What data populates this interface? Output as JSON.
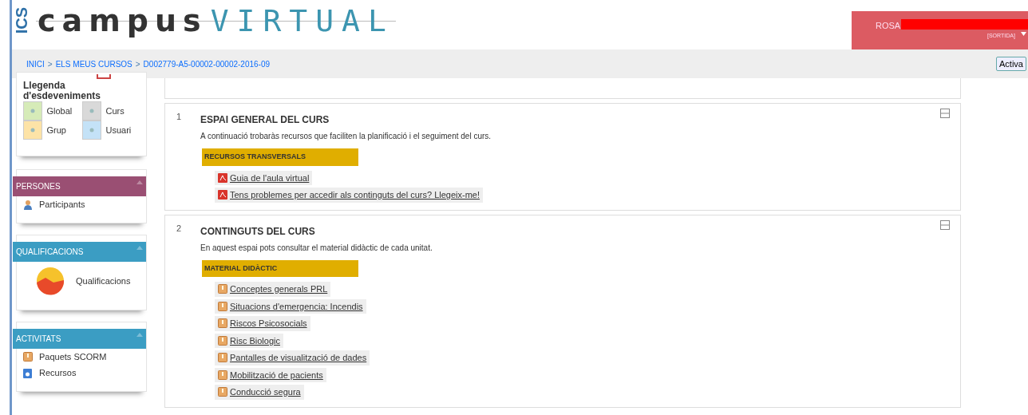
{
  "header": {
    "logo": {
      "side": "ICS",
      "word_1": "campus",
      "word_2": "VIRTUAL"
    },
    "user": {
      "name": "ROSA",
      "logout": "[SORTIDA]"
    }
  },
  "breadcrumb": [
    {
      "label": "INICI",
      "separator": ">"
    },
    {
      "label": "ELS MEUS CURSOS",
      "separator": ">"
    },
    {
      "label": "D002779-A5-00002-00002-2016-09"
    }
  ],
  "activate_button": "Activa",
  "sidebar": {
    "legend": {
      "title": "Llegenda d'esdeveniments",
      "items": [
        {
          "label": "Global",
          "color": "#d6ebb8"
        },
        {
          "label": "Curs",
          "color": "#d9d9d9"
        },
        {
          "label": "Grup",
          "color": "#fde3a7"
        },
        {
          "label": "Usuari",
          "color": "#c4e2f7"
        }
      ]
    },
    "blocks": [
      {
        "title": "PERSONES",
        "color": "#9a4f73",
        "items": [
          {
            "label": "Participants",
            "kind": "person"
          }
        ]
      },
      {
        "title": "QUALIFICACIONS",
        "color": "#3b9dc3",
        "items": [
          {
            "label": "Qualificacions",
            "kind": "chart"
          }
        ]
      },
      {
        "title": "ACTIVITATS",
        "color": "#3b9dc3",
        "items": [
          {
            "label": "Paquets SCORM",
            "kind": "package"
          },
          {
            "label": "Recursos",
            "kind": "resource"
          }
        ]
      }
    ]
  },
  "sections": [
    {
      "number": "1",
      "title": "ESPAI GENERAL DEL CURS",
      "description": "A continuació trobaràs recursos que faciliten la planificació i el seguiment del curs.",
      "heading": "RECURSOS TRANSVERSALS",
      "items": [
        {
          "label": "Guia de l'aula virtual",
          "kind": "pdf"
        },
        {
          "label": "Tens problemes per accedir als continguts del curs? Llegeix-me!",
          "kind": "pdf"
        }
      ]
    },
    {
      "number": "2",
      "title": "CONTINGUTS DEL CURS",
      "description": "En aquest espai pots consultar el material didàctic de cada unitat.",
      "heading": "MATERIAL DIDÀCTIC",
      "items": [
        {
          "label": "Conceptes generals PRL",
          "kind": "package"
        },
        {
          "label": "Situacions d'emergencia: Incendis",
          "kind": "package"
        },
        {
          "label": "Riscos Psicosocials",
          "kind": "package"
        },
        {
          "label": "Risc Biologic",
          "kind": "package"
        },
        {
          "label": "Pantalles de visualització de dades",
          "kind": "package"
        },
        {
          "label": "Mobilització de pacients",
          "kind": "package"
        },
        {
          "label": "Conducció segura",
          "kind": "package"
        }
      ]
    }
  ]
}
